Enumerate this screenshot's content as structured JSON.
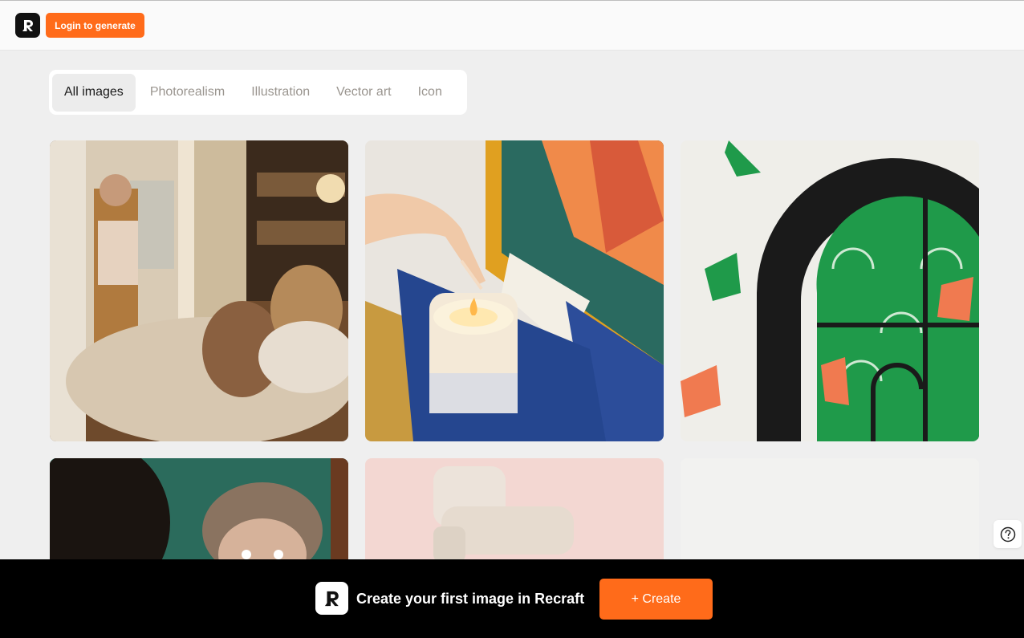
{
  "header": {
    "logo_icon": "recraft-logo-icon",
    "login_label": "Login to generate",
    "accent_color": "#ff6b1a"
  },
  "tabs": [
    {
      "label": "All images",
      "active": true
    },
    {
      "label": "Photorealism",
      "active": false
    },
    {
      "label": "Illustration",
      "active": false
    },
    {
      "label": "Vector art",
      "active": false
    },
    {
      "label": "Icon",
      "active": false
    }
  ],
  "gallery": [
    {
      "subject": "woman-in-doorway-photo"
    },
    {
      "subject": "lighting-candle-photo"
    },
    {
      "subject": "arched-window-illustration"
    },
    {
      "subject": "surprised-woman-photo"
    },
    {
      "subject": "lounge-chair-photo"
    },
    {
      "subject": "white-wall-photo"
    }
  ],
  "help": {
    "icon": "help-icon"
  },
  "banner": {
    "text": "Create your first image in Recraft",
    "create_label": "+ Create",
    "background": "#000000"
  }
}
